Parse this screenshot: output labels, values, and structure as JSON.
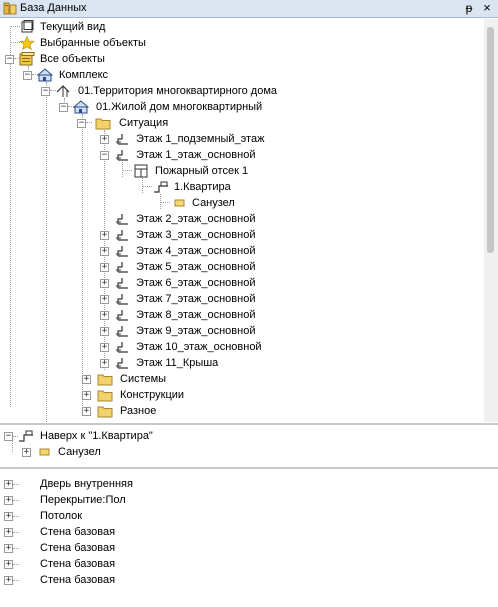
{
  "window": {
    "title": "База Данных",
    "pin_glyph": "ᵽ",
    "close_glyph": "×"
  },
  "tree": {
    "current_view": "Текущий вид",
    "favorites": "Выбранные объекты",
    "all_objects": "Все объекты",
    "complex": "Комплекс",
    "territory": "01.Территория многоквартирного дома",
    "building": "01.Жилой дом многоквартирный",
    "situation": "Ситуация",
    "floors": [
      "Этаж 1_подземный_этаж",
      "Этаж 1_этаж_основной",
      "Пожарный отсек 1",
      "1.Квартира",
      "Санузел",
      "Этаж 2_этаж_основной",
      "Этаж 3_этаж_основной",
      "Этаж 4_этаж_основной",
      "Этаж 5_этаж_основной",
      "Этаж 6_этаж_основной",
      "Этаж 7_этаж_основной",
      "Этаж 8_этаж_основной",
      "Этаж 9_этаж_основной",
      "Этаж 10_этаж_основной",
      "Этаж 11_Крыша"
    ],
    "systems": "Системы",
    "constructions": "Конструкции",
    "misc": "Разное"
  },
  "nav": {
    "up": "Наверх к \"1.Квартира\"",
    "child": "Санузел"
  },
  "elements": [
    "Дверь внутренняя",
    "Перекрытие:Пол",
    "Потолок",
    "Стена базовая",
    "Стена базовая",
    "Стена базовая",
    "Стена базовая"
  ],
  "icons": {
    "app": "database-icon",
    "view": "view-icon",
    "star": "star-icon",
    "objects": "objects-icon",
    "complex": "complex-icon",
    "territory": "territory-icon",
    "building": "building-icon",
    "folder": "folder-icon",
    "floor": "floor-icon",
    "fire": "fire-compartment-icon",
    "apartment": "apartment-icon",
    "room": "room-icon"
  },
  "colors": {
    "titlebar": "#dbe4f1",
    "folder": "#f2d16b",
    "room": "#f5d76e",
    "scroll_thumb": "#c6c6c6"
  }
}
